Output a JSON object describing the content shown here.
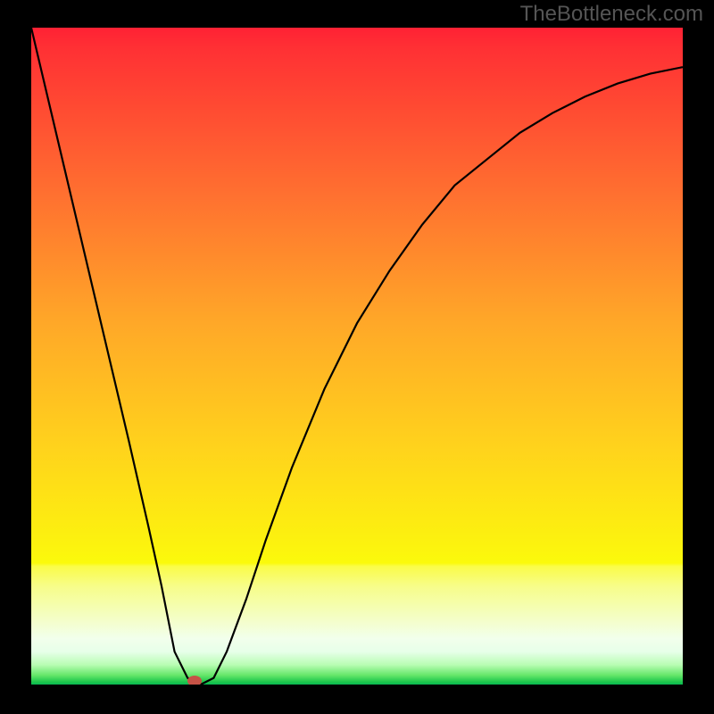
{
  "watermark": "TheBottleneck.com",
  "chart_data": {
    "type": "line",
    "title": "",
    "xlabel": "",
    "ylabel": "",
    "xlim": [
      0,
      100
    ],
    "ylim": [
      0,
      100
    ],
    "grid": false,
    "background_gradient": {
      "top": "#ff2134",
      "bottom": "#07b953",
      "description": "red (high) to green (low) vertical gradient"
    },
    "series": [
      {
        "name": "bottleneck-curve",
        "x": [
          0,
          5,
          10,
          15,
          18,
          20,
          22,
          24,
          26,
          28,
          30,
          33,
          36,
          40,
          45,
          50,
          55,
          60,
          65,
          70,
          75,
          80,
          85,
          90,
          95,
          100
        ],
        "values": [
          100,
          79,
          58,
          37,
          24,
          15,
          5,
          1,
          0,
          1,
          5,
          13,
          22,
          33,
          45,
          55,
          63,
          70,
          76,
          80,
          84,
          87,
          89.5,
          91.5,
          93,
          94
        ],
        "color": "#000000"
      }
    ],
    "marker": {
      "x": 25,
      "y": 0.5,
      "color": "#c65246"
    }
  }
}
